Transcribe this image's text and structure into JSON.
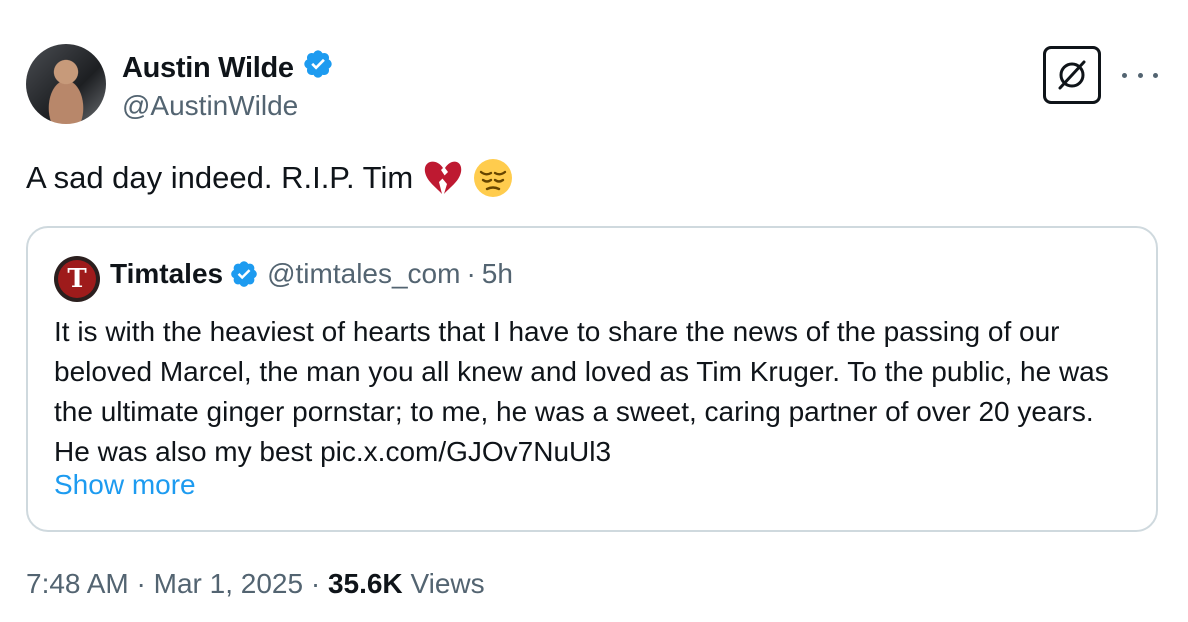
{
  "author": {
    "name": "Austin Wilde",
    "handle": "@AustinWilde",
    "verified": true
  },
  "tweet": {
    "text": "A sad day indeed. R.I.P. Tim",
    "emojis": [
      "broken-heart-emoji",
      "pensive-face-emoji"
    ]
  },
  "quote": {
    "name": "Timtales",
    "handle": "@timtales_com",
    "separator": "·",
    "age": "5h",
    "avatar_letter": "T",
    "body": "It is with the heaviest of hearts that I have to share the news of the passing of our beloved Marcel, the man you all knew and loved as Tim Kruger. To the public, he was the ultimate ginger pornstar; to me, he was a sweet, caring partner of over 20 years. He was also my best pic.x.com/GJOv7NuUl3",
    "show_more": "Show more"
  },
  "meta": {
    "time": "7:48 AM",
    "date": "Mar 1, 2025",
    "sep1": "·",
    "sep2": "·",
    "views_count": "35.6K",
    "views_label": "Views"
  },
  "colors": {
    "verified": "#1d9bf0",
    "link": "#1d9bf0",
    "secondary_text": "#536471",
    "border": "#cfd9de"
  }
}
